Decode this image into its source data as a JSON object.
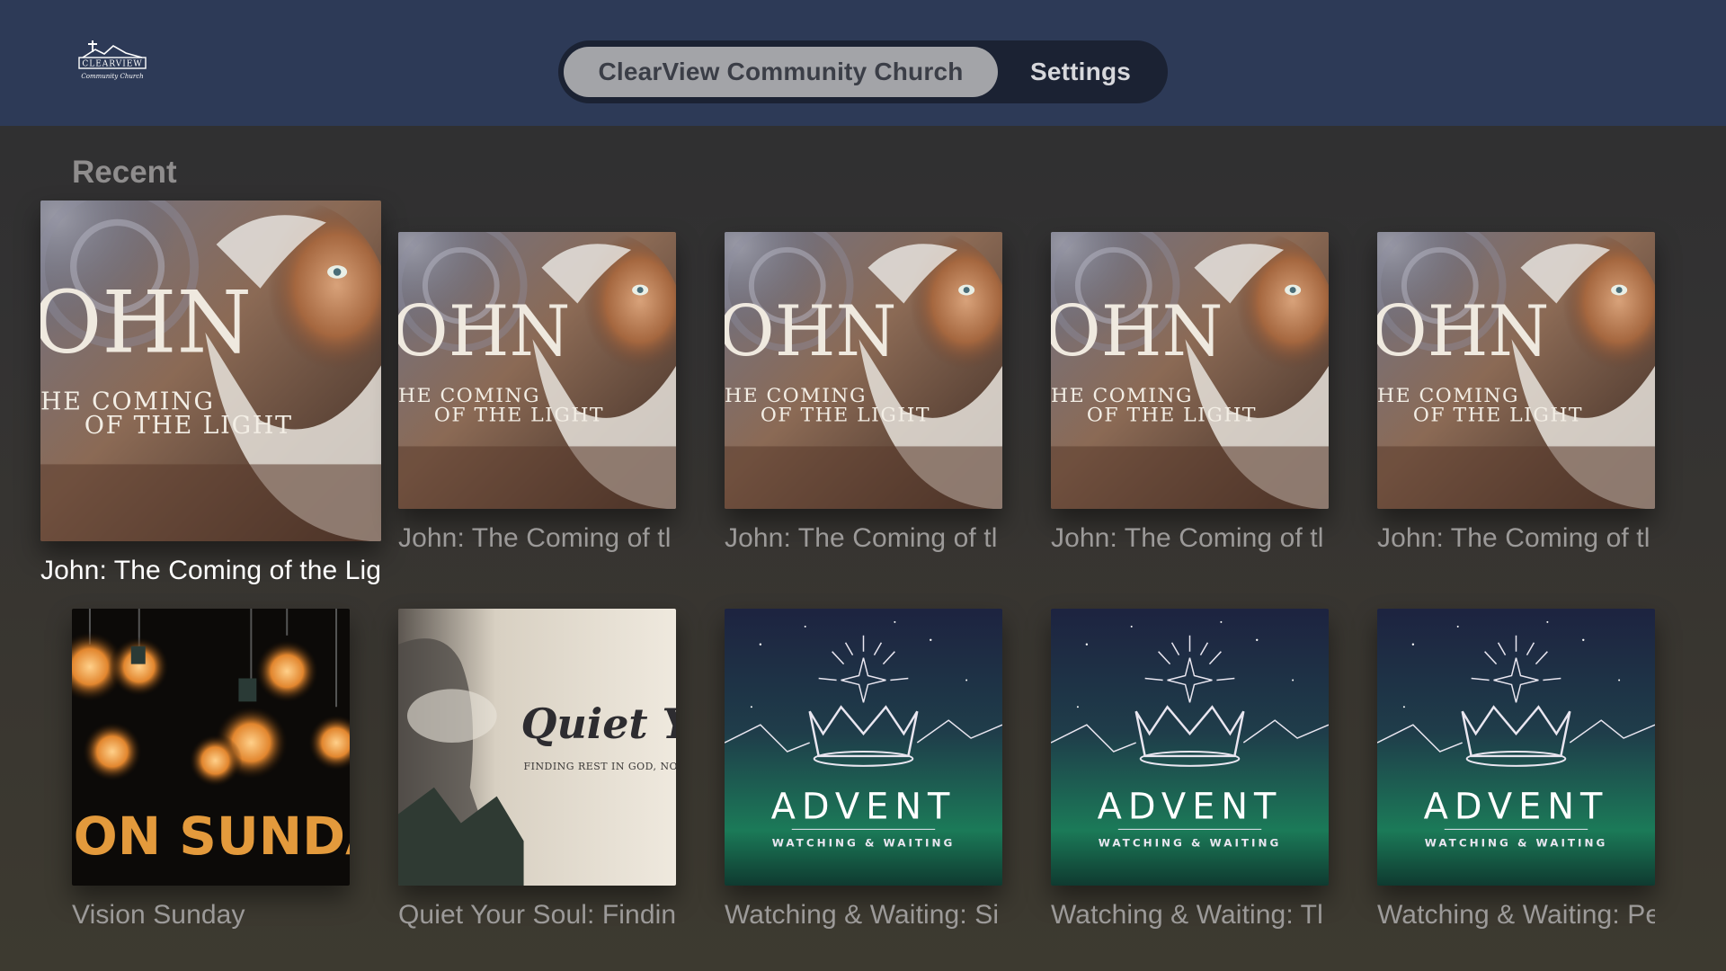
{
  "app": {
    "logo_text": "CLEARVIEW",
    "logo_subtext": "Community Church"
  },
  "tabs": [
    {
      "label": "ClearView Community Church",
      "selected": true
    },
    {
      "label": "Settings",
      "selected": false
    }
  ],
  "section": {
    "title": "Recent"
  },
  "row1": [
    {
      "title": "John: The Coming of the Lig",
      "art": "john-coming-of-the-light",
      "focused": true
    },
    {
      "title": "John: The Coming of tl",
      "art": "john-coming-of-the-light"
    },
    {
      "title": "John: The Coming of tl",
      "art": "john-coming-of-the-light"
    },
    {
      "title": "John: The Coming of tl",
      "art": "john-coming-of-the-light"
    },
    {
      "title": "John: The Coming of tl",
      "art": "john-coming-of-the-light"
    }
  ],
  "row2": [
    {
      "title": "Vision Sunday",
      "art": "vision-sunday"
    },
    {
      "title": "Quiet Your Soul: Findin",
      "art": "quiet-your-soul"
    },
    {
      "title": "Watching & Waiting: Si",
      "art": "advent"
    },
    {
      "title": "Watching & Waiting: Tl",
      "art": "advent"
    },
    {
      "title": "Watching & Waiting: Pe",
      "art": "advent"
    }
  ],
  "artwork": {
    "john": {
      "line1": "OHN",
      "line2": "HE COMING",
      "line3": "OF THE LIGHT"
    },
    "vision": {
      "text": "ION SUNDAY"
    },
    "quiet": {
      "title": "Quiet Your",
      "subtitle": "FINDING REST IN GOD, NOT I"
    },
    "advent": {
      "title": "ADVENT",
      "subtitle": "WATCHING & WAITING"
    }
  },
  "colors": {
    "topbar": "#2d3a57",
    "tab_active_bg": "#a3a4a8",
    "tab_track": "#1b2233",
    "caption": "#9c9a99",
    "caption_focused": "#ffffff"
  }
}
